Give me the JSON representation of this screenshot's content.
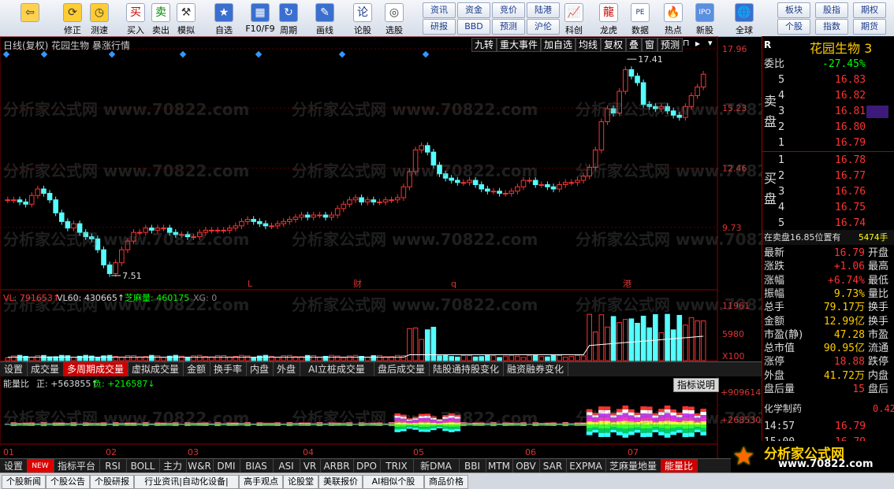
{
  "toolbar": {
    "items": [
      {
        "label": "",
        "icon": "back-arrow-icon"
      },
      {
        "label": "修正",
        "icon": "refresh-icon"
      },
      {
        "label": "测速",
        "icon": "clock-icon"
      },
      {
        "label": "买入",
        "icon": "buy-icon",
        "glyph": "买"
      },
      {
        "label": "卖出",
        "icon": "sell-icon",
        "glyph": "卖"
      },
      {
        "label": "模拟",
        "icon": "hammer-icon"
      },
      {
        "label": "自选",
        "icon": "star-icon"
      },
      {
        "label": "F10/F9",
        "icon": "grid-icon"
      },
      {
        "label": "周期",
        "icon": "cycle-icon"
      },
      {
        "label": "画线",
        "icon": "pen-icon"
      },
      {
        "label": "论股",
        "icon": "chat-icon",
        "glyph": "论"
      },
      {
        "label": "选股",
        "icon": "target-icon"
      },
      {
        "label": "科创",
        "icon": "chart-icon"
      },
      {
        "label": "龙虎",
        "icon": "dragon-icon"
      },
      {
        "label": "数据",
        "icon": "pe-icon",
        "glyph": "PE"
      },
      {
        "label": "热点",
        "icon": "fire-icon"
      },
      {
        "label": "新股",
        "icon": "ipo-icon",
        "glyph": "IPO"
      },
      {
        "label": "全球",
        "icon": "globe-icon"
      }
    ],
    "small_buttons": [
      "资讯",
      "资金",
      "竞价",
      "陆港",
      "研报",
      "BBD",
      "预测",
      "沪伦",
      "板块",
      "股指",
      "期权",
      "个股",
      "指数",
      "期货"
    ]
  },
  "chart": {
    "title": "日线(复权)  花园生物  暴涨行情",
    "top_buttons": [
      "九转",
      "重大事件",
      "加自选",
      "均线",
      "复权",
      "叠",
      "窗",
      "预测"
    ],
    "price_axis": [
      "17.96",
      "15.23",
      "12.46",
      "9.73"
    ],
    "high_label": "17.41",
    "low_label": "7.51",
    "markers": [
      "L",
      "财",
      "q",
      "港"
    ],
    "volume_header": {
      "vl": "VL: 791653↑",
      "vl60": "VL60: 430665↑",
      "zmlabel": "芝麻量: 460175",
      "xg": "XG: 0"
    },
    "volume_axis": [
      "11961",
      "5980",
      "X100"
    ],
    "vol_tabs": [
      "设置",
      "成交量",
      "多周期成交量",
      "虚拟成交量",
      "金额",
      "换手率",
      "内盘",
      "外盘",
      "AI立桩成交量",
      "盘后成交量",
      "陆股通持股变化",
      "融资融券变化"
    ],
    "energy_header": {
      "title": "能量比",
      "pos": "正: +563855↑",
      "neg": "负: +216587↓"
    },
    "energy_axis": [
      "+909614",
      "+268530"
    ],
    "indicator_button": "指标说明",
    "months": [
      "01",
      "02",
      "03",
      "04",
      "05",
      "06",
      "07"
    ],
    "ind_tabs": [
      "设置",
      "NEW",
      "指标平台",
      "RSI",
      "BOLL",
      "主力",
      "W&R",
      "DMI",
      "BIAS",
      "ASI",
      "VR",
      "ARBR",
      "DPO",
      "TRIX",
      "新DMA",
      "BBI",
      "MTM",
      "OBV",
      "SAR",
      "EXPMA",
      "芝麻量地量",
      "能量比"
    ],
    "watermark": "分析家公式网 www.70822.com"
  },
  "quote": {
    "name": "花园生物 3",
    "r": "R",
    "weibi_label": "委比",
    "weibi": "-27.45%",
    "sell_label": "卖盘",
    "sells": [
      {
        "n": "5",
        "p": "16.83"
      },
      {
        "n": "4",
        "p": "16.82"
      },
      {
        "n": "3",
        "p": "16.81"
      },
      {
        "n": "2",
        "p": "16.80"
      },
      {
        "n": "1",
        "p": "16.79"
      }
    ],
    "buy_label": "买盘",
    "buys": [
      {
        "n": "1",
        "p": "16.78"
      },
      {
        "n": "2",
        "p": "16.77"
      },
      {
        "n": "3",
        "p": "16.76"
      },
      {
        "n": "4",
        "p": "16.75"
      },
      {
        "n": "5",
        "p": "16.74"
      }
    ],
    "inline": {
      "text": "在卖盘16.85位置有",
      "vol": "5474手"
    },
    "stats": [
      {
        "k": "最新",
        "v": "16.79",
        "k2": "开盘"
      },
      {
        "k": "涨跌",
        "v": "+1.06",
        "k2": "最高"
      },
      {
        "k": "涨幅",
        "v": "+6.74%",
        "k2": "最低"
      },
      {
        "k": "振幅",
        "v": "9.73%",
        "k2": "量比"
      },
      {
        "k": "总手",
        "v": "79.17万",
        "k2": "换手"
      },
      {
        "k": "金额",
        "v": "12.99亿",
        "k2": "换手"
      },
      {
        "k": "市盈(静)",
        "v": "47.28",
        "k2": "市盈"
      },
      {
        "k": "总市值",
        "v": "90.95亿",
        "k2": "流通"
      },
      {
        "k": "涨停",
        "v": "18.88",
        "k2": "跌停"
      },
      {
        "k": "外盘",
        "v": "41.72万",
        "k2": "内盘"
      },
      {
        "k": "盘后量",
        "v": "15",
        "k2": "盘后"
      }
    ],
    "industry": "化学制药",
    "industry_val": "0.42",
    "ticks": [
      {
        "t": "14:57",
        "p": "16.79"
      },
      {
        "t": "15:00",
        "p": "16.79"
      }
    ],
    "logo_text": "分析家公式网",
    "logo_url": "www.70822.com"
  },
  "status": [
    "个股新闻",
    "个股公告",
    "个股研报",
    "行业资讯|自动化设备|",
    "高手观点",
    "论股堂",
    "美联报价",
    "AI相似个股",
    "商品价格"
  ],
  "chart_data": {
    "type": "candlestick",
    "title": "日线(复权) 花园生物",
    "x_months": [
      "01",
      "02",
      "03",
      "04",
      "05",
      "06",
      "07"
    ],
    "ylim": [
      7.0,
      17.96
    ],
    "close": [
      11.0,
      11.0,
      10.9,
      10.8,
      11.2,
      11.5,
      11.3,
      11.0,
      10.4,
      10.0,
      9.7,
      9.9,
      9.5,
      9.3,
      9.2,
      8.7,
      8.0,
      7.6,
      8.1,
      8.7,
      9.1,
      9.5,
      9.5,
      9.7,
      9.6,
      9.7,
      9.7,
      9.5,
      9.4,
      9.4,
      9.3,
      9.3,
      9.5,
      9.6,
      9.6,
      9.6,
      9.6,
      9.7,
      9.8,
      10.0,
      10.1,
      10.0,
      9.9,
      9.8,
      9.8,
      9.9,
      10.0,
      10.1,
      10.2,
      10.3,
      10.2,
      10.3,
      10.3,
      10.2,
      10.3,
      10.6,
      10.8,
      11.0,
      11.1,
      10.9,
      11.0,
      10.9,
      10.9,
      11.0,
      11.0,
      11.1,
      11.6,
      12.3,
      13.3,
      13.5,
      13.2,
      12.6,
      12.2,
      12.0,
      11.9,
      11.8,
      11.8,
      11.9,
      11.7,
      11.5,
      11.4,
      11.4,
      11.3,
      11.3,
      11.4,
      11.6,
      11.9,
      11.9,
      11.7,
      11.7,
      11.6,
      11.5,
      11.7,
      11.8,
      11.8,
      11.9,
      12.1,
      12.5,
      13.3,
      14.6,
      15.2,
      15.0,
      16.0,
      17.0,
      16.7,
      16.4,
      15.4,
      15.3,
      15.2,
      15.3,
      15.1,
      14.9,
      14.8,
      15.3,
      15.8,
      16.2,
      16.79
    ],
    "volume_max": 11961
  }
}
